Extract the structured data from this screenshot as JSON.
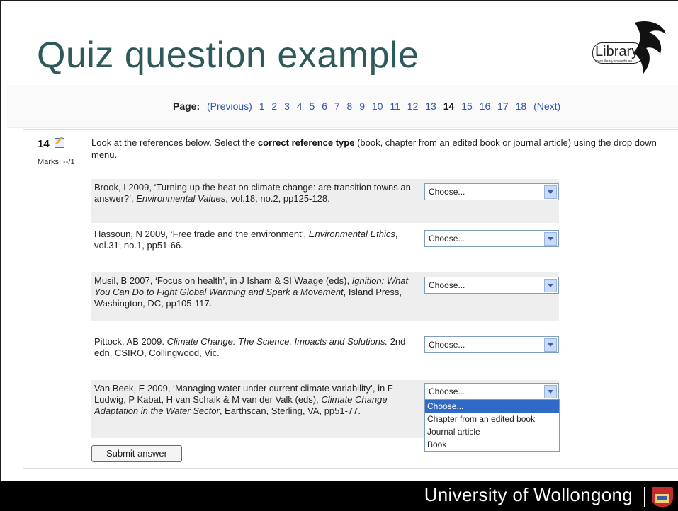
{
  "slide": {
    "title": "Quiz question example",
    "logo_text": "Library",
    "logo_url": "www.library.uow.edu.au",
    "footer": "University of Wollongong"
  },
  "pager": {
    "label": "Page:",
    "previous": "(Previous)",
    "pages": [
      "1",
      "2",
      "3",
      "4",
      "5",
      "6",
      "7",
      "8",
      "9",
      "10",
      "11",
      "12",
      "13",
      "14",
      "15",
      "16",
      "17",
      "18"
    ],
    "current": "14",
    "next": "(Next)"
  },
  "question": {
    "number": "14",
    "marks": "Marks: --/1",
    "text_before": "Look at the references below. Select the ",
    "text_bold": "correct reference type",
    "text_after": " (book, chapter from an edited book or journal article) using the drop down menu."
  },
  "references": [
    {
      "plain1": "Brook, I 2009, ‘Turning up the heat on climate change: are transition towns an answer?’, ",
      "ital": "Environmental Values",
      "plain2": ", vol.18, no.2, pp125-128.",
      "selected": "Choose..."
    },
    {
      "plain1": "Hassoun, N 2009, ‘Free trade and the environment’, ",
      "ital": "Environmental Ethics",
      "plain2": ", vol.31, no.1, pp51-66.",
      "selected": "Choose..."
    },
    {
      "plain1": "Musil, B 2007, ‘Focus on health’, in J Isham & SI Waage (eds), ",
      "ital": "Ignition: What You Can Do to Fight Global Warming and Spark a Movement",
      "plain2": ", Island Press, Washington, DC, pp105-117.",
      "selected": "Choose..."
    },
    {
      "plain1": "Pittock, AB 2009. ",
      "ital": "Climate Change: The Science, Impacts and Solutions.",
      "plain2": " 2nd edn, CSIRO, Collingwood, Vic.",
      "selected": "Choose..."
    },
    {
      "plain1": "Van Beek, E 2009, ‘Managing water under current climate variability’, in F Ludwig, P Kabat, H van Schaik & M van der Valk (eds), ",
      "ital": "Climate Change Adaptation in the Water Sector",
      "plain2": ", Earthscan, Sterling, VA, pp51-77.",
      "selected": "Choose..."
    }
  ],
  "dropdown_options": [
    "Choose...",
    "Chapter from an edited book",
    "Journal article",
    "Book"
  ],
  "submit_label": "Submit answer",
  "colors": {
    "title": "#2f5a5a",
    "link": "#3355aa",
    "highlight": "#316ac5"
  }
}
